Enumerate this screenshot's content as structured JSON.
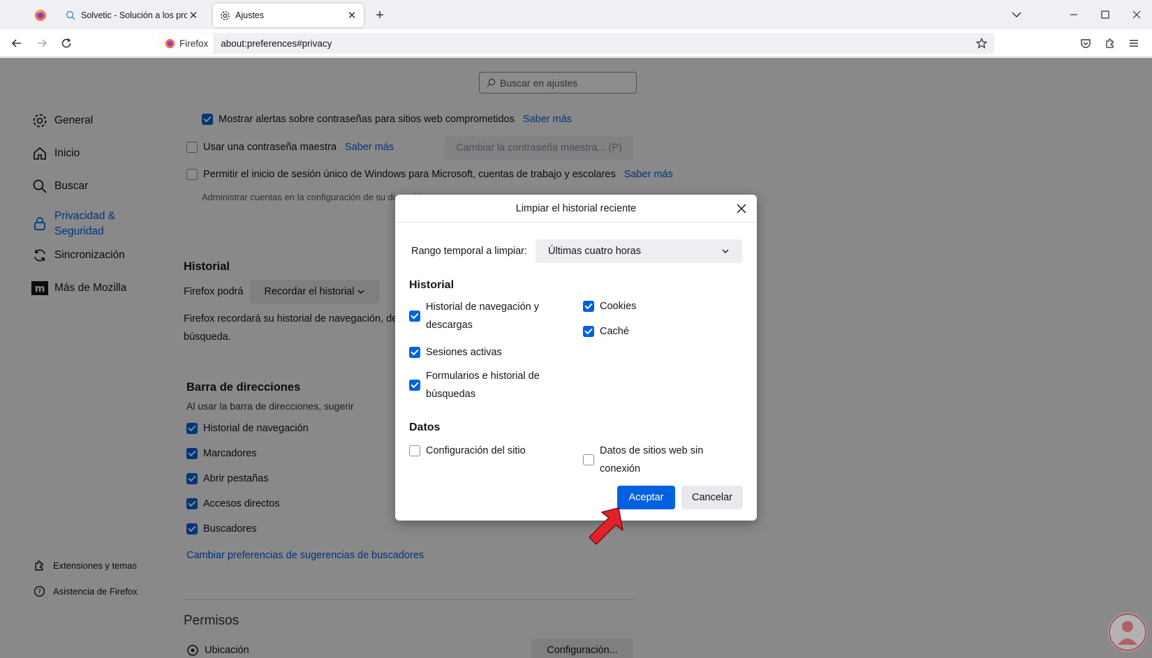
{
  "tabs": [
    {
      "title": "Solvetic - Solución a los problem",
      "active": false
    },
    {
      "title": "Ajustes",
      "active": true
    }
  ],
  "url": {
    "identity": "Firefox",
    "address": "about:preferences#privacy"
  },
  "search": {
    "placeholder": "Buscar en ajustes"
  },
  "sidebar": {
    "items": [
      {
        "label": "General"
      },
      {
        "label": "Inicio"
      },
      {
        "label": "Buscar"
      },
      {
        "label": "Privacidad & Seguridad",
        "line1": "Privacidad &",
        "line2": "Seguridad",
        "selected": true
      },
      {
        "label": "Sincronización"
      },
      {
        "label": "Más de Mozilla"
      }
    ],
    "footer": [
      {
        "label": "Extensiones y temas"
      },
      {
        "label": "Asistencia de Firefox"
      }
    ]
  },
  "passwords": {
    "alerts_label": "Mostrar alertas sobre contraseñas para sitios web comprometidos",
    "alerts_checked": true,
    "master_label": "Usar una contraseña maestra",
    "master_checked": false,
    "master_button": "Cambiar la contraseña maestra... (P)",
    "sso_label": "Permitir el inicio de sesión único de Windows para Microsoft, cuentas de trabajo y escolares",
    "sso_checked": false,
    "sso_sub": "Administrar cuentas en la configuración de su dispositivo",
    "learn_more": "Saber más"
  },
  "history": {
    "heading": "Historial",
    "firefox_will": "Firefox podrá",
    "mode": "Recordar el historial",
    "desc_line1": "Firefox recordará su historial de navegación, de",
    "desc_line2": "búsqueda."
  },
  "addressbar": {
    "heading": "Barra de direcciones",
    "sub": "Al usar la barra de direcciones, sugerir",
    "options": [
      {
        "label": "Historial de navegación",
        "checked": true
      },
      {
        "label": "Marcadores",
        "checked": true
      },
      {
        "label": "Abrir pestañas",
        "checked": true
      },
      {
        "label": "Accesos directos",
        "checked": true
      },
      {
        "label": "Buscadores",
        "checked": true
      }
    ],
    "link": "Cambiar preferencias de sugerencias de buscadores"
  },
  "permissions": {
    "heading": "Permisos",
    "location": "Ubicación",
    "settings_button": "Configuración..."
  },
  "dialog": {
    "title": "Limpiar el historial reciente",
    "range_label": "Rango temporal a limpiar:",
    "range_value": "Últimas cuatro horas",
    "history_heading": "Historial",
    "history_options": [
      {
        "line1": "Historial de navegación y",
        "line2": "descargas",
        "checked": true
      },
      {
        "line1": "Sesiones activas",
        "line2": "",
        "checked": true
      },
      {
        "line1": "Formularios e historial de",
        "line2": "búsquedas",
        "checked": true
      },
      {
        "line1": "Cookies",
        "line2": "",
        "checked": true
      },
      {
        "line1": "Caché",
        "line2": "",
        "checked": true
      }
    ],
    "data_heading": "Datos",
    "data_options": [
      {
        "line1": "Configuración del sitio",
        "line2": "",
        "checked": false
      },
      {
        "line1": "Datos de sitios web sin",
        "line2": "conexión",
        "checked": false
      }
    ],
    "accept": "Aceptar",
    "cancel": "Cancelar"
  },
  "colors": {
    "accent": "#0061e0",
    "arrow": "#e2222a"
  },
  "icons": [
    "firefox-icon",
    "search-icon",
    "gear-icon",
    "home-icon",
    "lock-icon",
    "sync-icon",
    "mozilla-icon",
    "puzzle-icon",
    "help-icon",
    "location-icon",
    "star-icon",
    "pocket-icon",
    "close-icon",
    "chevron-down-icon"
  ]
}
